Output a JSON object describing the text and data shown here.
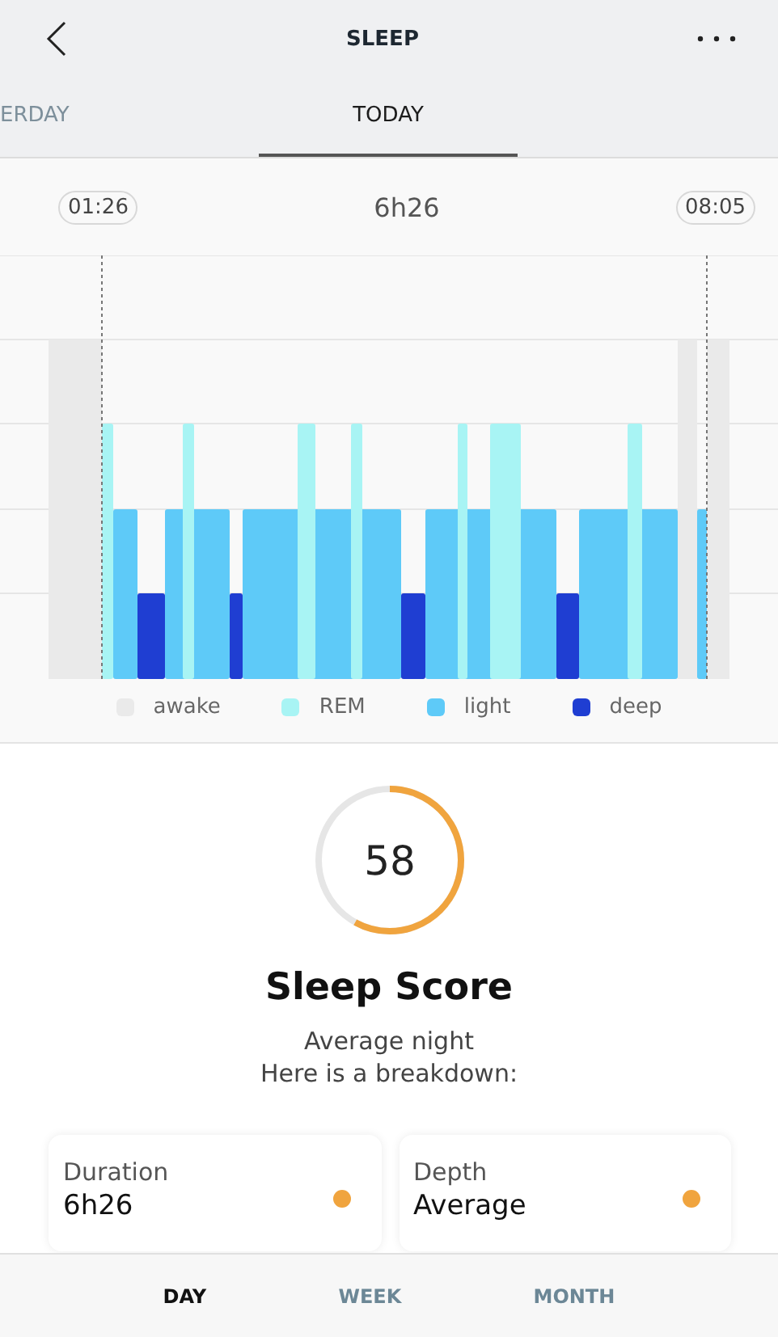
{
  "header": {
    "title": "SLEEP"
  },
  "tabs": [
    {
      "label": "ERDAY",
      "selected": false
    },
    {
      "label": "TODAY",
      "selected": true
    }
  ],
  "hypnogram": {
    "start": "01:26",
    "duration": "6h26",
    "end": "08:05",
    "legend": [
      {
        "label": "awake",
        "color": "#eaeaea"
      },
      {
        "label": "REM",
        "color": "#a8f4f4"
      },
      {
        "label": "light",
        "color": "#5ecaf8"
      },
      {
        "label": "deep",
        "color": "#1f3ed2"
      }
    ]
  },
  "score": {
    "value": "58",
    "level": 0.58,
    "title": "Sleep Score",
    "summary": [
      "Average night",
      "Here is a breakdown:"
    ]
  },
  "cards": [
    {
      "label": "Duration",
      "value": "6h26",
      "color": "#f0a43e"
    },
    {
      "label": "Depth",
      "value": "Average",
      "color": "#f0a43e"
    }
  ],
  "bottom_tabs": [
    {
      "label": "DAY",
      "selected": true
    },
    {
      "label": "WEEK",
      "selected": false
    },
    {
      "label": "MONTH",
      "selected": false
    }
  ]
}
